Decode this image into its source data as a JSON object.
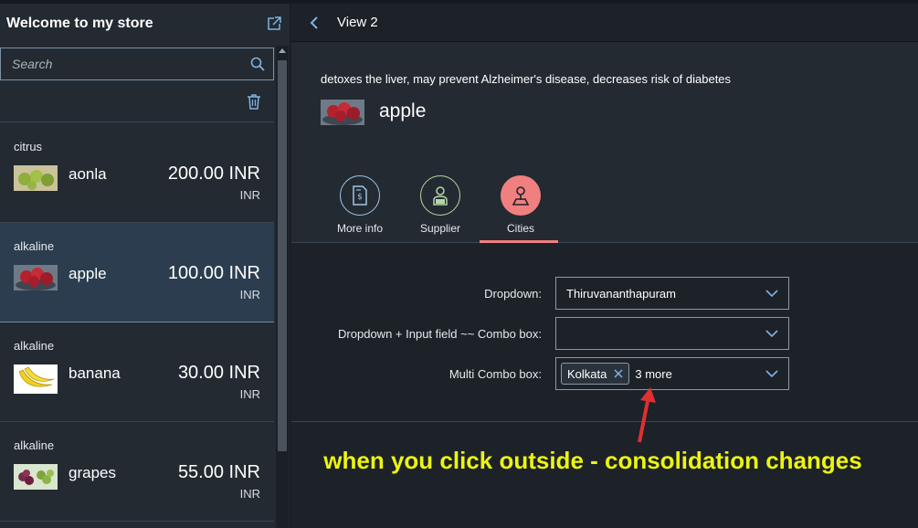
{
  "master": {
    "title": "Welcome to my store",
    "search_placeholder": "Search",
    "items": [
      {
        "category": "citrus",
        "name": "aonla",
        "price": "200.00 INR",
        "unit": "INR",
        "selected": false
      },
      {
        "category": "alkaline",
        "name": "apple",
        "price": "100.00 INR",
        "unit": "INR",
        "selected": true
      },
      {
        "category": "alkaline",
        "name": "banana",
        "price": "30.00 INR",
        "unit": "INR",
        "selected": false
      },
      {
        "category": "alkaline",
        "name": "grapes",
        "price": "55.00 INR",
        "unit": "INR",
        "selected": false
      }
    ]
  },
  "detail": {
    "title": "View 2",
    "description": "detoxes the liver, may prevent Alzheimer's disease, decreases risk of diabetes",
    "object_name": "apple",
    "tabs": [
      {
        "label": "More info",
        "icon": "document-money-icon",
        "color": "#9fc5e8",
        "selected": false
      },
      {
        "label": "Supplier",
        "icon": "supplier-icon",
        "color": "#b6d7a8",
        "selected": false
      },
      {
        "label": "Cities",
        "icon": "location-icon",
        "color": "#f08080",
        "selected": true
      }
    ],
    "form": {
      "dropdown_label": "Dropdown:",
      "dropdown_value": "Thiruvananthapuram",
      "combo_label": "Dropdown + Input field ~~ Combo box:",
      "combo_value": "",
      "multi_label": "Multi Combo box:",
      "multi_token": "Kolkata",
      "multi_more": "3 more"
    },
    "annotation": "when you click outside - consolidation changes"
  },
  "colors": {
    "annotation": "#ecf510",
    "arrow": "#e03030",
    "accent": "#f08080"
  }
}
